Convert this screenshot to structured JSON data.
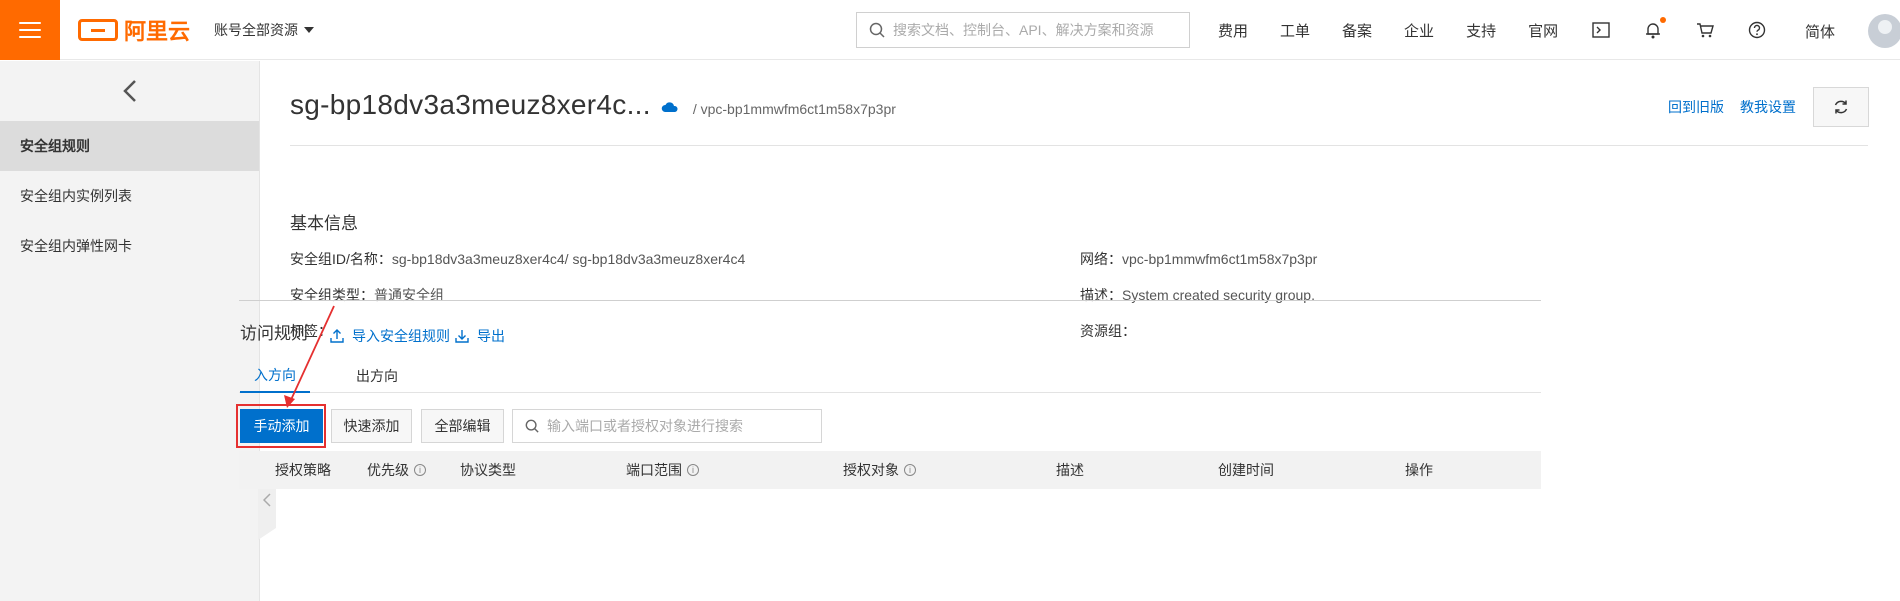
{
  "header": {
    "logo_text": "阿里云",
    "account_menu": "账号全部资源",
    "search_placeholder": "搜索文档、控制台、API、解决方案和资源",
    "nav_links": [
      "费用",
      "工单",
      "备案",
      "企业",
      "支持",
      "官网"
    ],
    "icons": [
      "terminal-icon",
      "bell-icon",
      "cart-icon",
      "help-icon"
    ],
    "language": "简体"
  },
  "sidebar": {
    "items": [
      {
        "label": "安全组规则",
        "active": true
      },
      {
        "label": "安全组内实例列表",
        "active": false
      },
      {
        "label": "安全组内弹性网卡",
        "active": false
      }
    ]
  },
  "page": {
    "title": "sg-bp18dv3a3meuz8xer4c...",
    "vpc_path": "/ vpc-bp1mmwfm6ct1m58x7p3pr",
    "link_old_version": "回到旧版",
    "link_tutorial": "教我设置"
  },
  "basic_info": {
    "section_title": "基本信息",
    "id_name_label": "安全组ID/名称：",
    "id_name_value": "sg-bp18dv3a3meuz8xer4c4/ sg-bp18dv3a3meuz8xer4c4",
    "network_label": "网络：",
    "network_value": "vpc-bp1mmwfm6ct1m58x7p3pr",
    "type_label": "安全组类型：",
    "type_value": "普通安全组",
    "desc_label": "描述：",
    "desc_value": "System created security group.",
    "tags_label": "标签：",
    "resource_group_label": "资源组："
  },
  "access_rules": {
    "section_title": "访问规则",
    "import_link": "导入安全组规则",
    "export_link": "导出",
    "tabs": [
      "入方向",
      "出方向"
    ],
    "active_tab": "入方向",
    "buttons": {
      "manual_add": "手动添加",
      "quick_add": "快速添加",
      "edit_all": "全部编辑"
    },
    "search_placeholder": "输入端口或者授权对象进行搜索",
    "columns": [
      "授权策略",
      "优先级",
      "协议类型",
      "端口范围",
      "授权对象",
      "描述",
      "创建时间",
      "操作"
    ]
  },
  "colors": {
    "brand_orange": "#ff6a00",
    "link_blue": "#0070cc",
    "annotation_red": "#e53030"
  }
}
